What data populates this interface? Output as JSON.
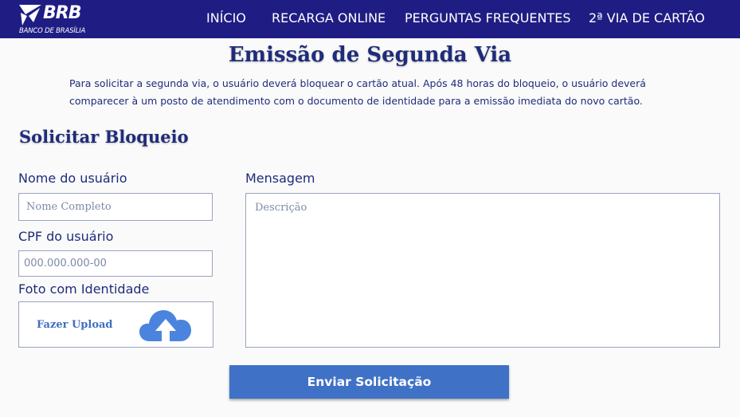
{
  "brand": {
    "name": "BRB",
    "subtitle": "BANCO DE BRASÍLIA"
  },
  "nav": {
    "items": [
      {
        "label": "INÍCIO"
      },
      {
        "label": "RECARGA ONLINE"
      },
      {
        "label": "PERGUNTAS FREQUENTES"
      },
      {
        "label": "2ª VIA DE CARTÃO"
      }
    ]
  },
  "page": {
    "title": "Emissão de Segunda Via",
    "intro": "Para solicitar a segunda via, o usuário deverá bloquear o cartão atual. Após 48 horas do bloqueio, o usuário deverá comparecer à um posto de atendimento com o documento de identidade para a emissão imediata do novo cartão."
  },
  "form": {
    "section_title": "Solicitar Bloqueio",
    "name_label": "Nome do usuário",
    "name_placeholder": "Nome Completo",
    "cpf_label": "CPF do usuário",
    "cpf_placeholder": "000.000.000-00",
    "photo_label": "Foto com Identidade",
    "upload_label": "Fazer Upload",
    "upload_icon": "cloud-upload-icon",
    "message_label": "Mensagem",
    "message_placeholder": "Descrição",
    "submit_label": "Enviar Solicitação"
  },
  "colors": {
    "navbar": "#1f1d84",
    "heading": "#1f2c7a",
    "accent": "#3f72c6",
    "upload_icon": "#4b84de"
  }
}
